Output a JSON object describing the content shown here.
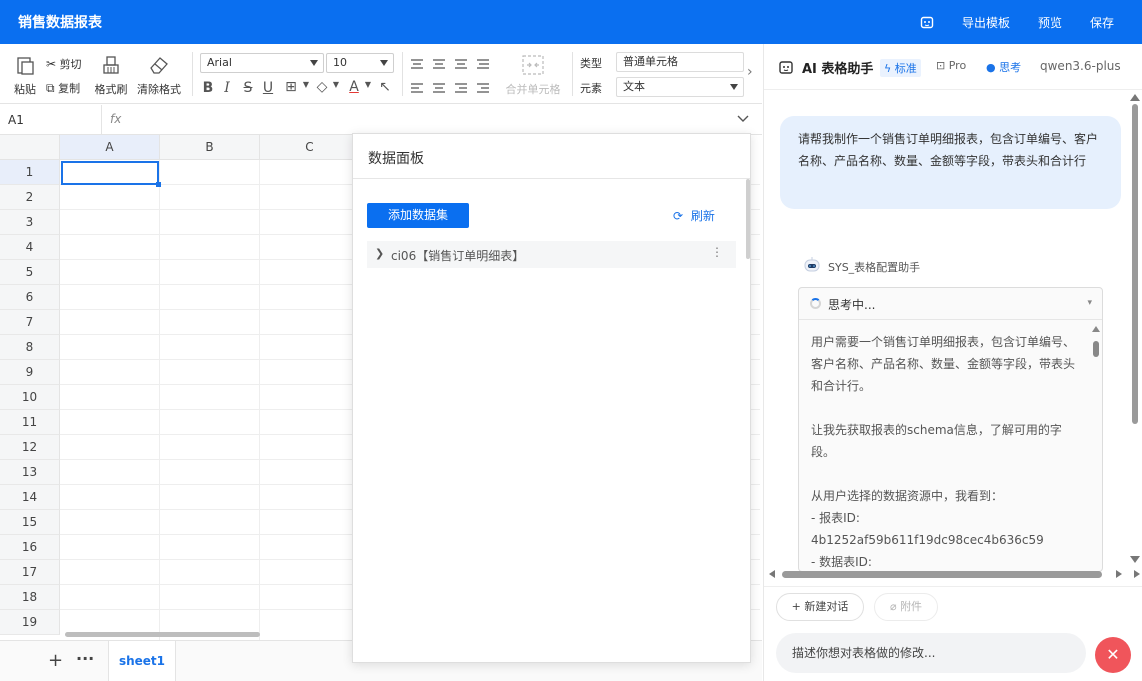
{
  "header": {
    "title": "销售数据报表",
    "export_template": "导出模板",
    "preview": "预览",
    "save": "保存"
  },
  "toolbar": {
    "paste": "粘贴",
    "cut": "剪切",
    "copy": "复制",
    "format_brush": "格式刷",
    "clear_format": "清除格式",
    "font_family": "Arial",
    "font_size": "10",
    "merge_cells": "合并单元格",
    "type_label": "类型",
    "type_value": "普通单元格",
    "element_label": "元素",
    "element_value": "文本"
  },
  "formula_bar": {
    "cell_ref": "A1",
    "fx": "fx"
  },
  "grid": {
    "columns": [
      "A",
      "B",
      "C"
    ],
    "rows": [
      "1",
      "2",
      "3",
      "4",
      "5",
      "6",
      "7",
      "8",
      "9",
      "10",
      "11",
      "12",
      "13",
      "14",
      "15",
      "16",
      "17",
      "18",
      "19"
    ]
  },
  "sheets": {
    "active": "sheet1"
  },
  "data_panel": {
    "title": "数据面板",
    "add_dataset": "添加数据集",
    "refresh": "刷新",
    "dataset_name": "ci06【销售订单明细表】"
  },
  "ai_assistant": {
    "title": "AI 表格助手",
    "mode_standard": "标准",
    "mode_pro": "Pro",
    "think": "思考",
    "model": "qwen3.6-plus",
    "user_message": "请帮我制作一个销售订单明细报表，包含订单编号、客户名称、产品名称、数量、金额等字段，带表头和合计行",
    "assistant_name": "SYS_表格配置助手",
    "thinking_label": "思考中...",
    "thinking_p1": "用户需要一个销售订单明细报表，包含订单编号、客户名称、产品名称、数量、金额等字段，带表头和合计行。",
    "thinking_p2": "让我先获取报表的schema信息，了解可用的字段。",
    "thinking_p3a": "从用户选择的数据资源中，我看到：",
    "thinking_p3b": "- 报表ID:",
    "thinking_p3c": "4b1252af59b611f19dc98cec4b636c59",
    "thinking_p3d": "- 数据表ID:",
    "new_chat": "新建对话",
    "attachment": "附件",
    "input_placeholder": "描述你想对表格做的修改..."
  },
  "colors": {
    "brand": "#0a6ff0",
    "link": "#1a73e8",
    "stop": "#f0555b"
  }
}
